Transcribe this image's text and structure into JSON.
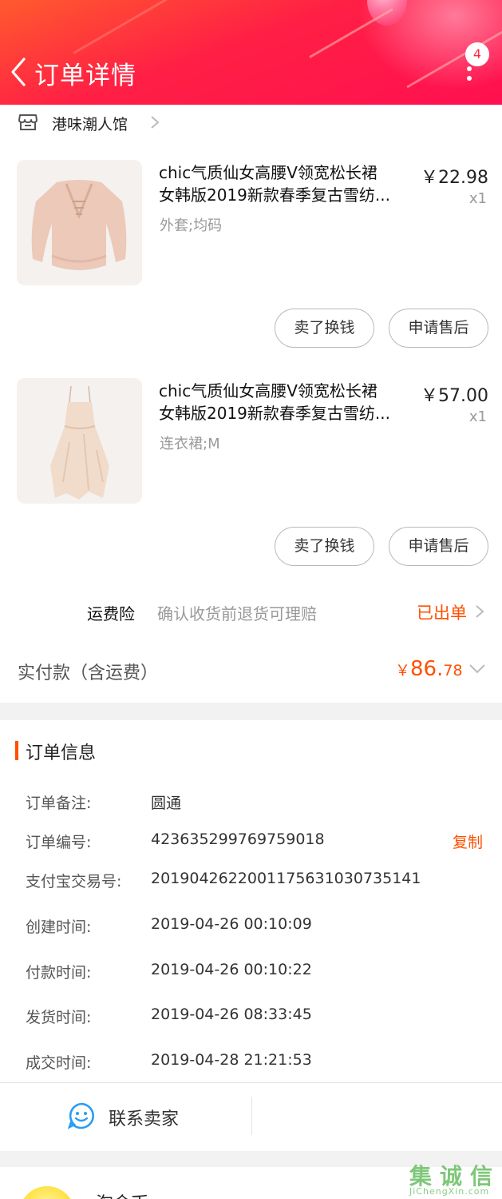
{
  "header": {
    "title": "订单详情",
    "badge_count": "4",
    "colors": {
      "start": "#ff5a2e",
      "end": "#ff1050"
    }
  },
  "store": {
    "name": "港味潮人馆"
  },
  "products": [
    {
      "title_line1": "chic气质仙女高腰V领宽松长裙",
      "title_line2": "女韩版2019新款春季复古雪纺...",
      "price": "￥22.98",
      "qty": "x1",
      "spec": "外套;均码",
      "buttons": [
        "卖了换钱",
        "申请售后"
      ]
    },
    {
      "title_line1": "chic气质仙女高腰V领宽松长裙",
      "title_line2": "女韩版2019新款春季复古雪纺...",
      "price": "￥57.00",
      "qty": "x1",
      "spec": "连衣裙;M",
      "buttons": [
        "卖了换钱",
        "申请售后"
      ]
    }
  ],
  "insurance": {
    "label": "运费险",
    "desc": "确认收货前退货可理赔",
    "status": "已出单"
  },
  "total": {
    "label": "实付款（含运费）",
    "currency": "￥",
    "integer": "86.",
    "decimal": "78"
  },
  "order_info": {
    "title": "订单信息",
    "rows": [
      {
        "key": "订单备注:",
        "value": "圆通"
      },
      {
        "key": "订单编号:",
        "value": "423635299769759018"
      },
      {
        "key": "支付宝交易号:",
        "value": "2019042622001175631030735141"
      },
      {
        "key": "创建时间:",
        "value": "2019-04-26 00:10:09"
      },
      {
        "key": "付款时间:",
        "value": "2019-04-26 00:10:22"
      },
      {
        "key": "发货时间:",
        "value": "2019-04-26 08:33:45"
      },
      {
        "key": "成交时间:",
        "value": "2019-04-28 21:21:53"
      }
    ],
    "copy_label": "复制"
  },
  "contact": {
    "label": "联系卖家"
  },
  "bottom": {
    "name": "淘金币"
  },
  "watermark": {
    "chars": [
      "集",
      "诚",
      "信"
    ],
    "sub": "JiChengXin.com"
  },
  "accent_color": "#ff5000"
}
